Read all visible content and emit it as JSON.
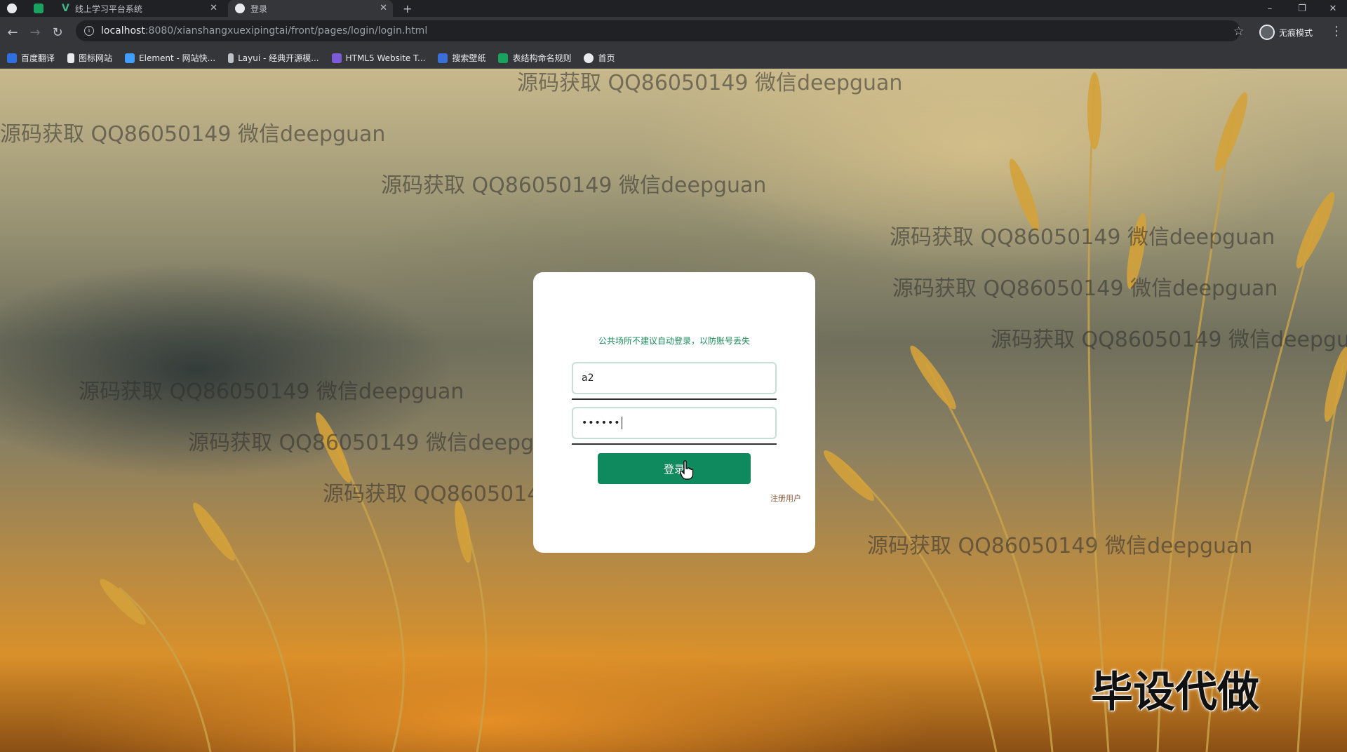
{
  "browser": {
    "tabs": [
      {
        "title": "线上学习平台系统",
        "active": false
      },
      {
        "title": "登录",
        "active": true
      }
    ],
    "new_tab": "+",
    "window_controls": [
      "–",
      "❐",
      "✕"
    ],
    "url_host": "localhost",
    "url_path": ":8080/xianshangxuexipingtai/front/pages/login/login.html",
    "incognito_label": "无痕模式",
    "bookmarks": [
      {
        "label": "百度翻译",
        "color": "#2f6fe0"
      },
      {
        "label": "图标网站",
        "color": "#e8eaed"
      },
      {
        "label": "Element - 网站快...",
        "color": "#409eff"
      },
      {
        "label": "Layui - 经典开源模...",
        "color": "#bdc1c6"
      },
      {
        "label": "HTML5 Website T...",
        "color": "#7b5cd6"
      },
      {
        "label": "搜索壁纸",
        "color": "#3b6fd8"
      },
      {
        "label": "表结构命名规则",
        "color": "#1aa260"
      },
      {
        "label": "首页",
        "color": "#e8eaed"
      }
    ]
  },
  "watermark_text": "源码获取 QQ86050149 微信deepguan",
  "watermark_short": "源码获取 QQ86050149 微信deepgua",
  "corner_text": "毕设代做",
  "login": {
    "notice": "公共场所不建议自动登录，以防账号丢失",
    "username_value": "a2",
    "password_value": "••••••",
    "login_button": "登录",
    "register_link": "注册用户"
  },
  "colors": {
    "accent": "#0f8a5f",
    "notice_text": "#1e8a5c",
    "register_link": "#8a5a3c"
  }
}
